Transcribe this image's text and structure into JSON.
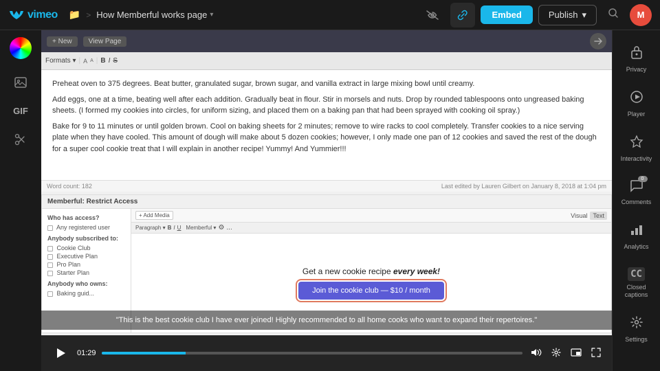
{
  "topbar": {
    "logo": "vimeo",
    "breadcrumb": {
      "folder_icon": "📁",
      "separator": ">",
      "title": "How Memberful works page",
      "arrow": "▾"
    },
    "embed_label": "Embed",
    "publish_label": "Publish",
    "publish_arrow": "▾",
    "avatar_initials": "M"
  },
  "left_sidebar": {
    "icons": [
      {
        "name": "color-wheel",
        "symbol": "◑"
      },
      {
        "name": "image",
        "symbol": "🖼"
      },
      {
        "name": "gif",
        "label": "GIF"
      },
      {
        "name": "scissors",
        "symbol": "✂"
      }
    ]
  },
  "editor": {
    "topbar": {
      "new_btn": "+ New",
      "view_page_btn": "View Page"
    },
    "toolbar_label": "Formats ▾",
    "content": {
      "paragraph1": "Preheat oven to 375 degrees. Beat butter, granulated sugar, brown sugar, and vanilla extract in large mixing bowl until creamy.",
      "paragraph2": "Add eggs, one at a time, beating well after each addition. Gradually beat in flour. Stir in morsels and nuts. Drop by rounded tablespoons onto ungreased baking sheets. (I formed my cookies into circles, for uniform sizing, and placed them on a baking pan that had been sprayed with cooking oil spray.)",
      "paragraph3": "Bake for 9 to 11 minutes or until golden brown. Cool on baking sheets for 2 minutes; remove to wire racks to cool completely. Transfer cookies to a nice serving plate when they have cooled. This amount of dough will make about 5 dozen cookies; however, I only made one pan of 12 cookies and saved the rest of the dough for a super cool cookie treat that I will explain in another recipe! Yummy! And Yummier!!!"
    },
    "footer": {
      "word_count": "Word count: 182",
      "last_edited": "Last edited by Lauren Gilbert on January 8, 2018 at 1:04 pm"
    }
  },
  "restrict_box": {
    "title": "Memberful: Restrict Access",
    "left": {
      "label": "Who has access?",
      "option1": "Any registered user",
      "subscribed_label": "Anybody subscribed to:",
      "plan1": "Cookie Club",
      "plan2": "Executive Plan",
      "plan3": "Pro Plan",
      "plan4": "Starter Plan",
      "owns_label": "Anybody who owns:",
      "baking_guide": "Baking guid..."
    },
    "right": {
      "add_media_btn": "+ Add Media",
      "visual_tab": "Visual",
      "text_tab": "Text",
      "promo_title_plain": "Get a new cookie recipe ",
      "promo_title_em": "every week!",
      "join_btn": "Join the cookie club — $10 / month"
    }
  },
  "video_player": {
    "time": "01:29",
    "transcript": "\"This is the best cookie club I have ever joined! Highly recommended to all home cooks who want to expand their repertoires.\"",
    "controls": {
      "volume": "🔊",
      "settings": "⚙",
      "pip": "⧉",
      "fullscreen": "⛶"
    }
  },
  "right_sidebar": {
    "items": [
      {
        "name": "privacy",
        "icon": "🔒",
        "label": "Privacy"
      },
      {
        "name": "player",
        "icon": "▶",
        "label": "Player"
      },
      {
        "name": "interactivity",
        "icon": "⚡",
        "label": "Interactivity"
      },
      {
        "name": "comments",
        "icon": "💬",
        "label": "Comments",
        "badge": "0"
      },
      {
        "name": "analytics",
        "icon": "📊",
        "label": "Analytics"
      },
      {
        "name": "closed-captions",
        "icon": "CC",
        "label": "Closed captions"
      },
      {
        "name": "settings",
        "icon": "⚙",
        "label": "Settings"
      }
    ]
  }
}
